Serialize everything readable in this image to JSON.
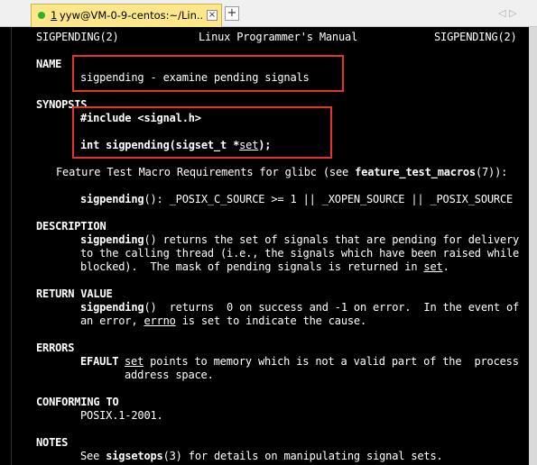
{
  "tab": {
    "number": "1",
    "title": "yyw@VM-0-9-centos:~/Lin...",
    "close": "×",
    "new_tab": "+"
  },
  "window_controls": "◁ ▷",
  "man": {
    "header_left": "SIGPENDING(2)",
    "header_center": "Linux Programmer's Manual",
    "header_right": "SIGPENDING(2)",
    "name_heading": "NAME",
    "name_line": "sigpending - examine pending signals",
    "synopsis_heading": "SYNOPSIS",
    "include": "#include <signal.h>",
    "proto_pre": "int sigpending(sigset_t *",
    "proto_arg": "set",
    "proto_post": ");",
    "ftm_pre": "Feature Test Macro Requirements for glibc (see ",
    "ftm_link": "feature_test_macros",
    "ftm_post": "(7)):",
    "ftm_func": "sigpending",
    "ftm_rest": "(): _POSIX_C_SOURCE >= 1 || _XOPEN_SOURCE || _POSIX_SOURCE",
    "desc_heading": "DESCRIPTION",
    "desc1_func": "sigpending",
    "desc1_rest": "() returns the set of signals that are pending for delivery",
    "desc2": "to the calling thread (i.e., the signals which have been raised while",
    "desc3_pre": "blocked).  The mask of pending signals is returned in ",
    "desc3_arg": "set",
    "desc3_post": ".",
    "ret_heading": "RETURN VALUE",
    "ret1_func": "sigpending",
    "ret1_rest": "()  returns  0 on success and -1 on error.  In the event of",
    "ret2_pre": "an error, ",
    "ret2_errno": "errno",
    "ret2_post": " is set to indicate the cause.",
    "errors_heading": "ERRORS",
    "efault": "EFAULT",
    "efault_arg": "set",
    "efault_rest": " points to memory which is not a valid part of the  process",
    "efault2": "address space.",
    "conf_heading": "CONFORMING TO",
    "conf_text": "POSIX.1-2001.",
    "notes_heading": "NOTES",
    "notes_pre": "See ",
    "notes_link": "sigsetops",
    "notes_post": "(3) for details on manipulating signal sets."
  }
}
